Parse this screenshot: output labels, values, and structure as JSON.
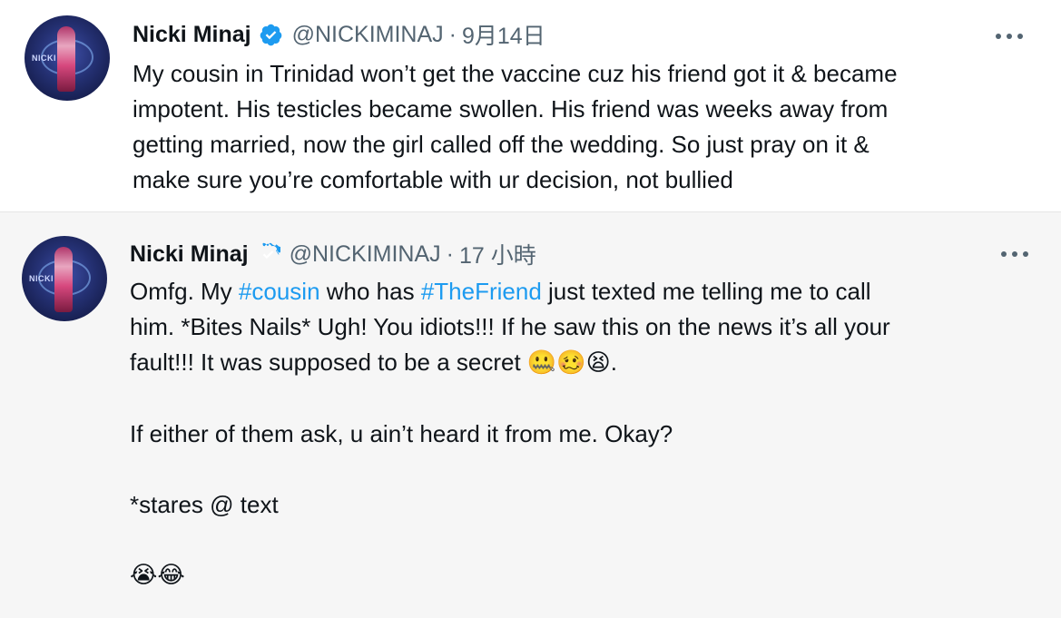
{
  "tweets": [
    {
      "author": {
        "name": "Nicki Minaj",
        "handle": "@NICKIMINAJ",
        "avatar_text": "NICKI"
      },
      "separator": "·",
      "timestamp": "9月14日",
      "more_icon": "more-horizontal-icon",
      "lines": [
        "My cousin in Trinidad won’t get the vaccine cuz his friend got it & became",
        "impotent. His testicles became swollen. His friend was weeks away from",
        "getting married, now the girl called off the wedding. So just pray on it &",
        "make sure you’re comfortable with ur decision, not bullied"
      ]
    },
    {
      "author": {
        "name": "Nicki Minaj",
        "handle": "@NICKIMINAJ",
        "avatar_text": "NICKI"
      },
      "separator": "·",
      "timestamp": "17 小時",
      "more_icon": "more-horizontal-icon",
      "line1": {
        "pre": "Omfg. My ",
        "hashtag1": "#cousin",
        "mid": " who has ",
        "hashtag2": "#TheFriend",
        "post": " just texted me telling me to call"
      },
      "line2": "him. *Bites Nails* Ugh! You idiots!!! If he saw this on the news it’s all your",
      "line3": {
        "text": "fault!!! It was supposed to be a secret ",
        "emojis": "🤐🥴😫",
        "end": "."
      },
      "line4": "If either of them ask, u ain’t heard it from me. Okay?",
      "line5": "*stares @ text",
      "line6_emojis": "😭😂"
    }
  ],
  "colors": {
    "verified": "#1d9bf0",
    "hashtag": "#1d9bf0",
    "secondary_text": "#536471",
    "highlight_background": "#f6f6f6"
  }
}
